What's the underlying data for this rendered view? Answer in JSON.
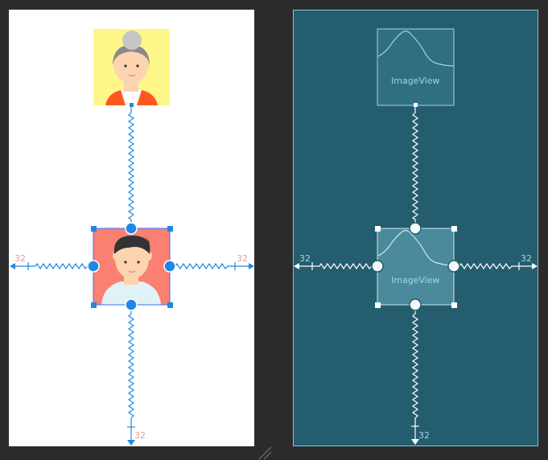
{
  "design": {
    "margin_left": "32",
    "margin_right": "32",
    "margin_bottom": "32"
  },
  "blueprint": {
    "top_view_label": "ImageView",
    "center_view_label": "ImageView",
    "margin_left": "32",
    "margin_right": "32",
    "margin_bottom": "32"
  },
  "colors": {
    "canvas": "#2b2b2d",
    "design_bg": "#ffffff",
    "blueprint_bg": "#245d6e",
    "constraint_blue": "#1e88e5",
    "blueprint_line": "#ffffff",
    "margin_text_design": "#e0a0a0",
    "margin_text_blueprint": "#9fd6e3"
  }
}
